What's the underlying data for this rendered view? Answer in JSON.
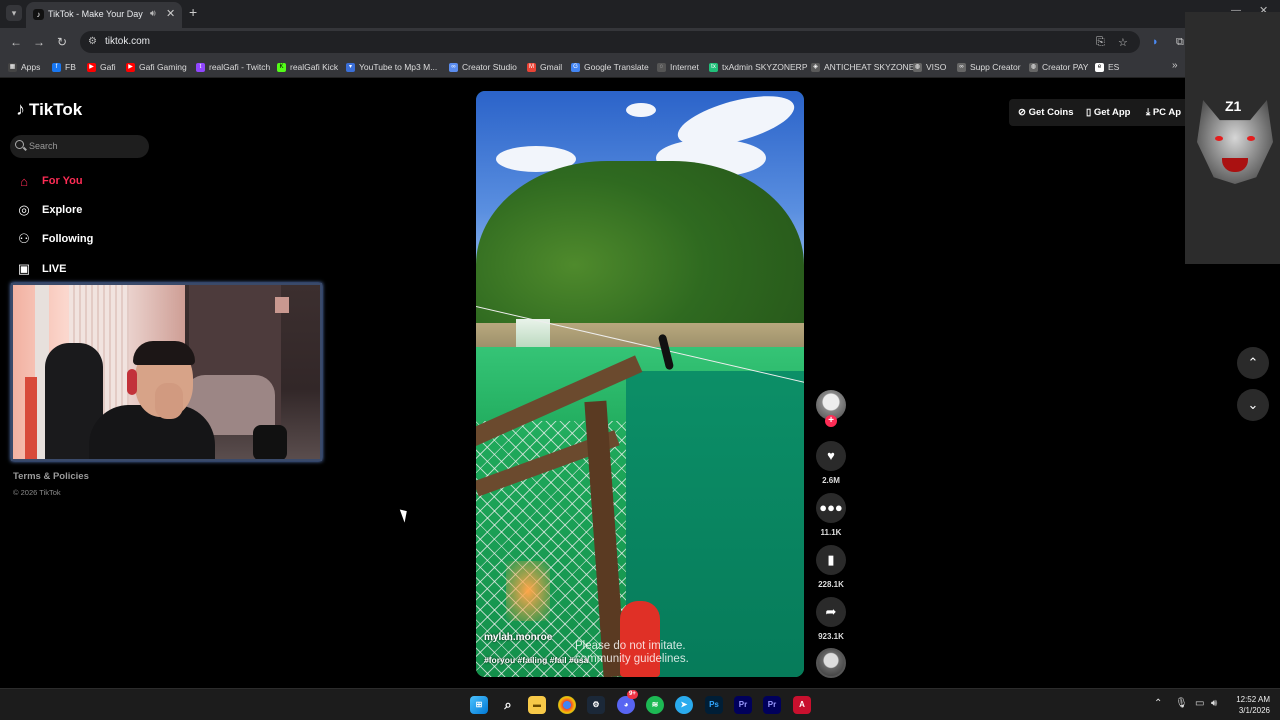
{
  "browser": {
    "tab_title": "TikTok - Make Your Day",
    "url": "tiktok.com",
    "bookmarks": [
      {
        "label": "Apps",
        "color": "#9aa0a6"
      },
      {
        "label": "FB",
        "color": "#1877f2"
      },
      {
        "label": "Gafi",
        "color": "#ff0000"
      },
      {
        "label": "Gafi Gaming",
        "color": "#ff0000"
      },
      {
        "label": "realGafi - Twitch",
        "color": "#9146ff"
      },
      {
        "label": "realGafi Kick",
        "color": "#53fc18"
      },
      {
        "label": "YouTube to Mp3 M...",
        "color": "#3b6fd8"
      },
      {
        "label": "Creator Studio",
        "color": "#5b8def"
      },
      {
        "label": "Gmail",
        "color": "#ea4335"
      },
      {
        "label": "Google Translate",
        "color": "#4285f4"
      },
      {
        "label": "Internet",
        "color": "#9aa0a6"
      },
      {
        "label": "txAdmin SKYZONERP",
        "color": "#21c07a"
      },
      {
        "label": "ANTICHEAT SKYZONE",
        "color": "#5a5a5a"
      },
      {
        "label": "VISO",
        "color": "#9aa0a6"
      },
      {
        "label": "Supp Creator",
        "color": "#9aa0a6"
      },
      {
        "label": "Creator PAY",
        "color": "#9aa0a6"
      },
      {
        "label": "ES",
        "color": "#ffffff"
      }
    ]
  },
  "tiktok": {
    "logo_text": "TikTok",
    "search_placeholder": "Search",
    "nav": {
      "for_you": "For You",
      "explore": "Explore",
      "following": "Following",
      "live": "LIVE"
    },
    "footer": {
      "terms": "Terms & Policies",
      "copyright": "© 2026 TikTok"
    },
    "video": {
      "author": "mylah.monroe",
      "hashtags": "#foryou #failing #fail #usa",
      "warning_line1": "Please do not imitate.",
      "warning_line2": "community guidelines."
    },
    "actions": {
      "likes": "2.6M",
      "comments": "11.1K",
      "saves": "228.1K",
      "shares": "923.1K"
    },
    "top_bar": {
      "get_coins": "Get Coins",
      "get_app": "Get App",
      "pc_app": "PC Ap"
    },
    "accent_color": "#fe2c55"
  },
  "stream_logo_text": "Z1",
  "taskbar": {
    "time": "12:52 AM",
    "date": "3/1/2026",
    "discord_badge": "9+"
  },
  "icons": [
    "tiktok-logo-icon",
    "search-icon",
    "home-icon",
    "compass-icon",
    "person-icon",
    "live-tv-icon",
    "heart-icon",
    "comment-icon",
    "bookmark-icon",
    "share-icon",
    "chevron-up-icon",
    "chevron-down-icon",
    "coin-icon",
    "phone-icon",
    "download-icon"
  ]
}
